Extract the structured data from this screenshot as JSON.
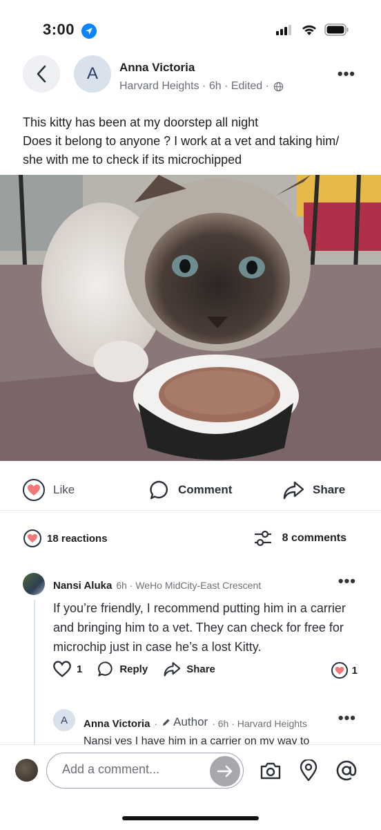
{
  "status_bar": {
    "time": "3:00"
  },
  "post": {
    "author": "Anna Victoria",
    "avatar_letter": "A",
    "meta": "Harvard Heights · 6h · Edited ·",
    "text_line1": "This kitty has been at my doorstep all night",
    "text_line2": "Does it belong to anyone ? I work at a vet and taking him/",
    "text_line3": "she with me to check if its microchipped"
  },
  "actions": {
    "like": "Like",
    "comment": "Comment",
    "share": "Share"
  },
  "summary": {
    "reactions": "18 reactions",
    "comments": "8 comments"
  },
  "comment": {
    "author": "Nansi Aluka",
    "meta": "6h · WeHo MidCity-East Crescent",
    "text": "If you’re friendly, I recommend putting him in a carrier and bringing him to a vet. They can check for free for microchip just in case he’s a lost Kitty.",
    "like_count": "1",
    "reply_label": "Reply",
    "share_label": "Share",
    "reaction_count": "1"
  },
  "reply": {
    "avatar_letter": "A",
    "author": "Anna Victoria",
    "author_badge": "Author",
    "meta": "· 6h · Harvard Heights",
    "text": "Nansi yes I have him in a carrier on my way to"
  },
  "composer": {
    "placeholder": "Add a comment..."
  },
  "colors": {
    "heart": "#f07878",
    "accent": "#0a84ff"
  }
}
